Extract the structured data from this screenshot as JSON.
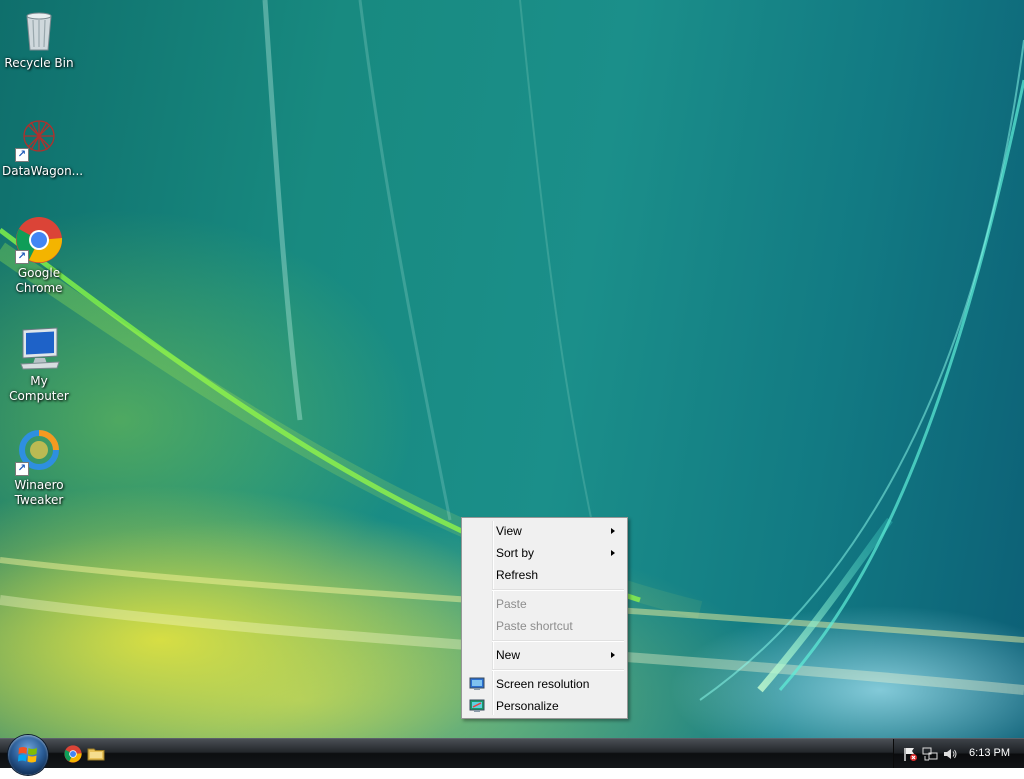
{
  "desktop": {
    "icons": [
      {
        "label": "Recycle Bin",
        "icon": "recycle-bin-icon",
        "shortcut": false
      },
      {
        "label": "DataWagon...",
        "icon": "datawagon-icon",
        "shortcut": true
      },
      {
        "label": "Google Chrome",
        "icon": "chrome-icon",
        "shortcut": true
      },
      {
        "label": "My Computer",
        "icon": "computer-icon",
        "shortcut": false
      },
      {
        "label": "Winaero Tweaker",
        "icon": "winaero-tweaker-icon",
        "shortcut": true
      }
    ]
  },
  "context_menu": {
    "items": [
      {
        "label": "View",
        "submenu": true,
        "enabled": true
      },
      {
        "label": "Sort by",
        "submenu": true,
        "enabled": true
      },
      {
        "label": "Refresh",
        "submenu": false,
        "enabled": true
      },
      {
        "label": "Paste",
        "submenu": false,
        "enabled": false
      },
      {
        "label": "Paste shortcut",
        "submenu": false,
        "enabled": false
      },
      {
        "label": "New",
        "submenu": true,
        "enabled": true
      },
      {
        "label": "Screen resolution",
        "submenu": false,
        "enabled": true,
        "icon": "screen-resolution-icon"
      },
      {
        "label": "Personalize",
        "submenu": false,
        "enabled": true,
        "icon": "personalize-icon"
      }
    ]
  },
  "taskbar": {
    "start_icon": "windows-logo-icon",
    "quick_launch": [
      "chrome-icon",
      "folder-icon"
    ],
    "tray_icons": [
      "action-center-flag-icon",
      "network-icon",
      "volume-icon"
    ],
    "clock": "6:13 PM"
  },
  "colors": {
    "menu_background": "#f0f0f0",
    "menu_disabled_text": "#8d8d8d",
    "taskbar": "#14171a"
  }
}
